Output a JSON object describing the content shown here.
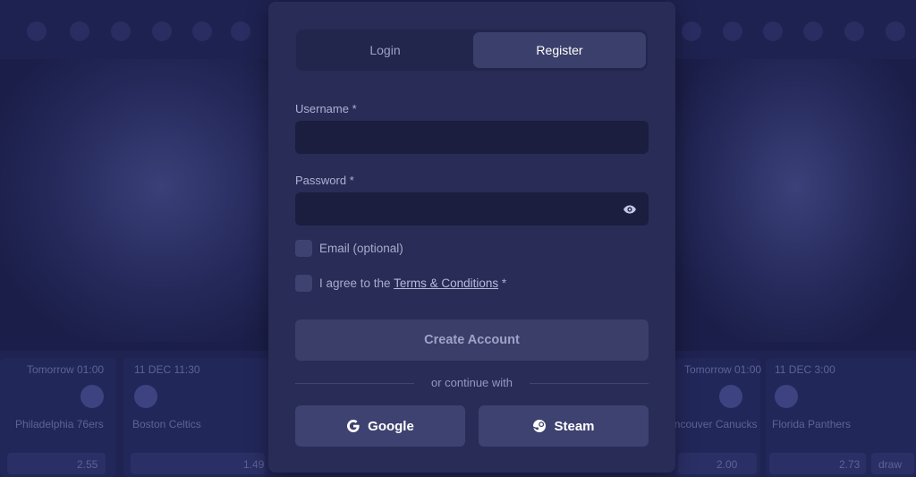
{
  "background": {
    "matches": [
      {
        "time": "Tomorrow 01:00",
        "team": "Philadelphia 76ers",
        "odds": "2.55"
      },
      {
        "time": "11 DEC 11:30",
        "team": "Boston Celtics",
        "odds": "1.49"
      },
      {
        "time": "Tomorrow 01:00",
        "team": "Vancouver Canucks",
        "odds": "2.00"
      },
      {
        "time": "11 DEC 3:00",
        "team": "Florida Panthers",
        "odds": "2.73",
        "extra": "draw"
      }
    ]
  },
  "auth": {
    "tabs": {
      "login": "Login",
      "register": "Register"
    },
    "active_tab": "register",
    "username_label": "Username *",
    "username_value": "",
    "password_label": "Password *",
    "password_value": "",
    "email_optional_label": "Email (optional)",
    "agree_prefix": "I agree to the ",
    "terms_link": "Terms & Conditions",
    "agree_suffix": " *",
    "create_button": "Create Account",
    "divider_text": "or continue with",
    "google_button": "Google",
    "steam_button": "Steam"
  },
  "icons": {
    "password_toggle": "eye-icon",
    "google": "google-icon",
    "steam": "steam-icon"
  },
  "colors": {
    "modal_bg": "#282c56",
    "input_bg": "#1b1e3e",
    "active_tab_bg": "#3b3f6b",
    "button_bg": "#3e4270"
  }
}
